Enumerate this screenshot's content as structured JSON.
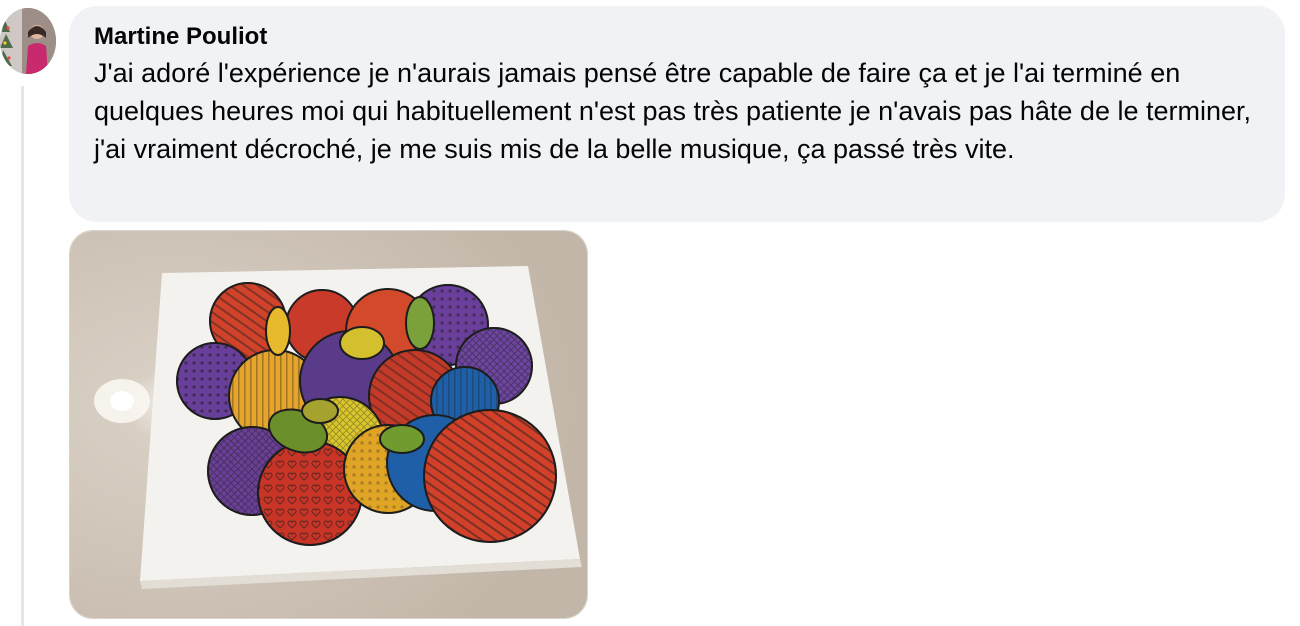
{
  "comment": {
    "author": "Martine Pouliot",
    "text": "J'ai adoré l'expérience je n'aurais jamais pensé être capable de faire ça et je l'ai terminé en quelques heures moi qui habituellement n'est pas très patiente je n'avais pas hâte de le terminer, j'ai vraiment décroché, je me suis mis de la belle musique, ça passé très vite."
  },
  "colors": {
    "bubble": "#f0f2f5",
    "text": "#050505",
    "thread_line": "#e4e6eb"
  },
  "icons": {
    "avatar": "profile-photo",
    "attachment": "colored-circles-drawing-photo"
  }
}
